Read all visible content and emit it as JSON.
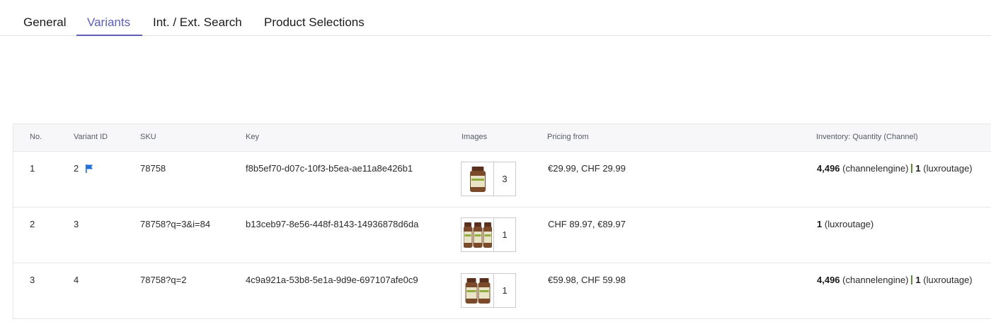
{
  "tabs": [
    {
      "label": "General",
      "active": false
    },
    {
      "label": "Variants",
      "active": true
    },
    {
      "label": "Int. / Ext. Search",
      "active": false
    },
    {
      "label": "Product Selections",
      "active": false
    }
  ],
  "columns": {
    "no": "No.",
    "variant_id": "Variant ID",
    "sku": "SKU",
    "key": "Key",
    "images": "Images",
    "pricing": "Pricing from",
    "inventory": "Inventory: Quantity (Channel)"
  },
  "rows": [
    {
      "no": "1",
      "variant_id": "2",
      "master_flag": true,
      "sku": "78758",
      "key": "f8b5ef70-d07c-10f3-b5ea-ae11a8e426b1",
      "image_bottles": 1,
      "image_count": "3",
      "pricing": "€29.99, CHF 29.99",
      "inventory": [
        {
          "qty": "4,496",
          "channel": "(channelengine)"
        },
        {
          "qty": "1",
          "channel": "(luxroutage)"
        }
      ]
    },
    {
      "no": "2",
      "variant_id": "3",
      "master_flag": false,
      "sku": "78758?q=3&i=84",
      "key": "b13ceb97-8e56-448f-8143-14936878d6da",
      "image_bottles": 3,
      "image_count": "1",
      "pricing": "CHF 89.97, €89.97",
      "inventory": [
        {
          "qty": "1",
          "channel": "(luxroutage)"
        }
      ]
    },
    {
      "no": "3",
      "variant_id": "4",
      "master_flag": false,
      "sku": "78758?q=2",
      "key": "4c9a921a-53b8-5e1a-9d9e-697107afe0c9",
      "image_bottles": 2,
      "image_count": "1",
      "pricing": "€59.98, CHF 59.98",
      "inventory": [
        {
          "qty": "4,496",
          "channel": "(channelengine)"
        },
        {
          "qty": "1",
          "channel": "(luxroutage)"
        }
      ]
    }
  ],
  "colors": {
    "accent": "#5b5fb5",
    "flag": "#1e6fd9",
    "inventory_separator": "#5b8a3a"
  },
  "icons": {
    "master": "flag-icon",
    "thumbnail": "supplement-bottle-icon"
  }
}
